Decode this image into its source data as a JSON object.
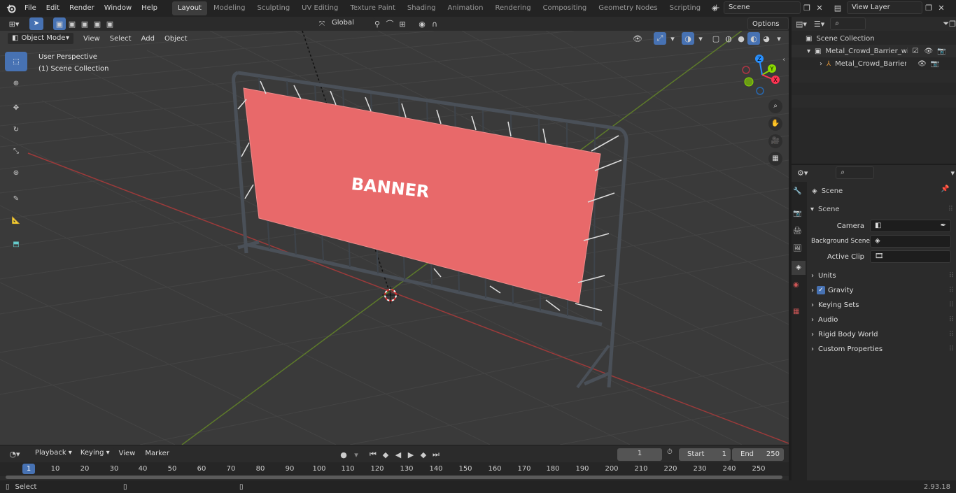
{
  "menu": [
    "File",
    "Edit",
    "Render",
    "Window",
    "Help"
  ],
  "workspaces": [
    "Layout",
    "Modeling",
    "Sculpting",
    "UV Editing",
    "Texture Paint",
    "Shading",
    "Animation",
    "Rendering",
    "Compositing",
    "Geometry Nodes",
    "Scripting"
  ],
  "scene_field": "Scene",
  "view_layer_field": "View Layer",
  "viewport": {
    "orientation": "Global",
    "options": "Options",
    "mode": "Object Mode",
    "menus": [
      "View",
      "Select",
      "Add",
      "Object"
    ],
    "overlay_line1": "User Perspective",
    "overlay_line2": "(1) Scene Collection",
    "banner_text": "BANNER",
    "gizmo": {
      "x": "X",
      "y": "Y",
      "z": "Z"
    }
  },
  "outliner": {
    "root": "Scene Collection",
    "item1": "Metal_Crowd_Barrier_with_Ac",
    "item2": "Metal_Crowd_Barrier_wit"
  },
  "properties": {
    "header": "Scene",
    "panel": "Scene",
    "camera_label": "Camera",
    "bg_scene_label": "Background Scene",
    "active_clip_label": "Active Clip",
    "sections": [
      "Units",
      "Gravity",
      "Keying Sets",
      "Audio",
      "Rigid Body World",
      "Custom Properties"
    ],
    "gravity_checked": true
  },
  "timeline": {
    "menus": [
      "Playback",
      "Keying",
      "View",
      "Marker"
    ],
    "current_frame": "1",
    "start_label": "Start",
    "start_value": "1",
    "end_label": "End",
    "end_value": "250",
    "ruler": [
      "1",
      "10",
      "20",
      "30",
      "40",
      "50",
      "60",
      "70",
      "80",
      "90",
      "100",
      "110",
      "120",
      "130",
      "140",
      "150",
      "160",
      "170",
      "180",
      "190",
      "200",
      "210",
      "220",
      "230",
      "240",
      "250"
    ]
  },
  "status": {
    "left": "Select",
    "version": "2.93.18"
  },
  "colors": {
    "accent": "#4772b3",
    "x_axis": "#ff3352",
    "y_axis": "#8bdc00",
    "z_axis": "#2890ff",
    "banner": "#e8696a"
  }
}
